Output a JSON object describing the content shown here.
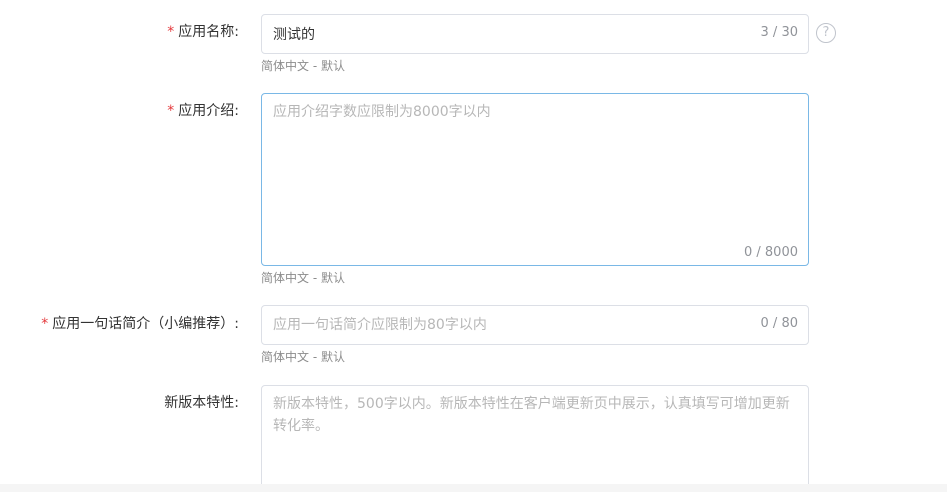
{
  "form": {
    "app_name": {
      "label": "应用名称:",
      "required_mark": "*",
      "value": "测试的",
      "counter": "3 / 30",
      "hint": "简体中文 - 默认",
      "help_icon": "question-circle-icon",
      "help_glyph": "?"
    },
    "app_intro": {
      "label": "应用介绍:",
      "required_mark": "*",
      "placeholder": "应用介绍字数应限制为8000字以内",
      "counter": "0 / 8000",
      "hint": "简体中文 - 默认"
    },
    "app_one_liner": {
      "label": "应用一句话简介（小编推荐）:",
      "required_mark": "*",
      "placeholder": "应用一句话简介应限制为80字以内",
      "counter": "0 / 80",
      "hint": "简体中文 - 默认"
    },
    "new_features": {
      "label": "新版本特性:",
      "placeholder": "新版本特性，500字以内。新版本特性在客户端更新页中展示，认真填写可增加更新转化率。"
    }
  },
  "colors": {
    "required": "#e4393c",
    "focus_border": "#7ab8e6",
    "border": "#dcdfe6",
    "placeholder": "#b7b7b7",
    "hint": "#8c8c8c"
  }
}
